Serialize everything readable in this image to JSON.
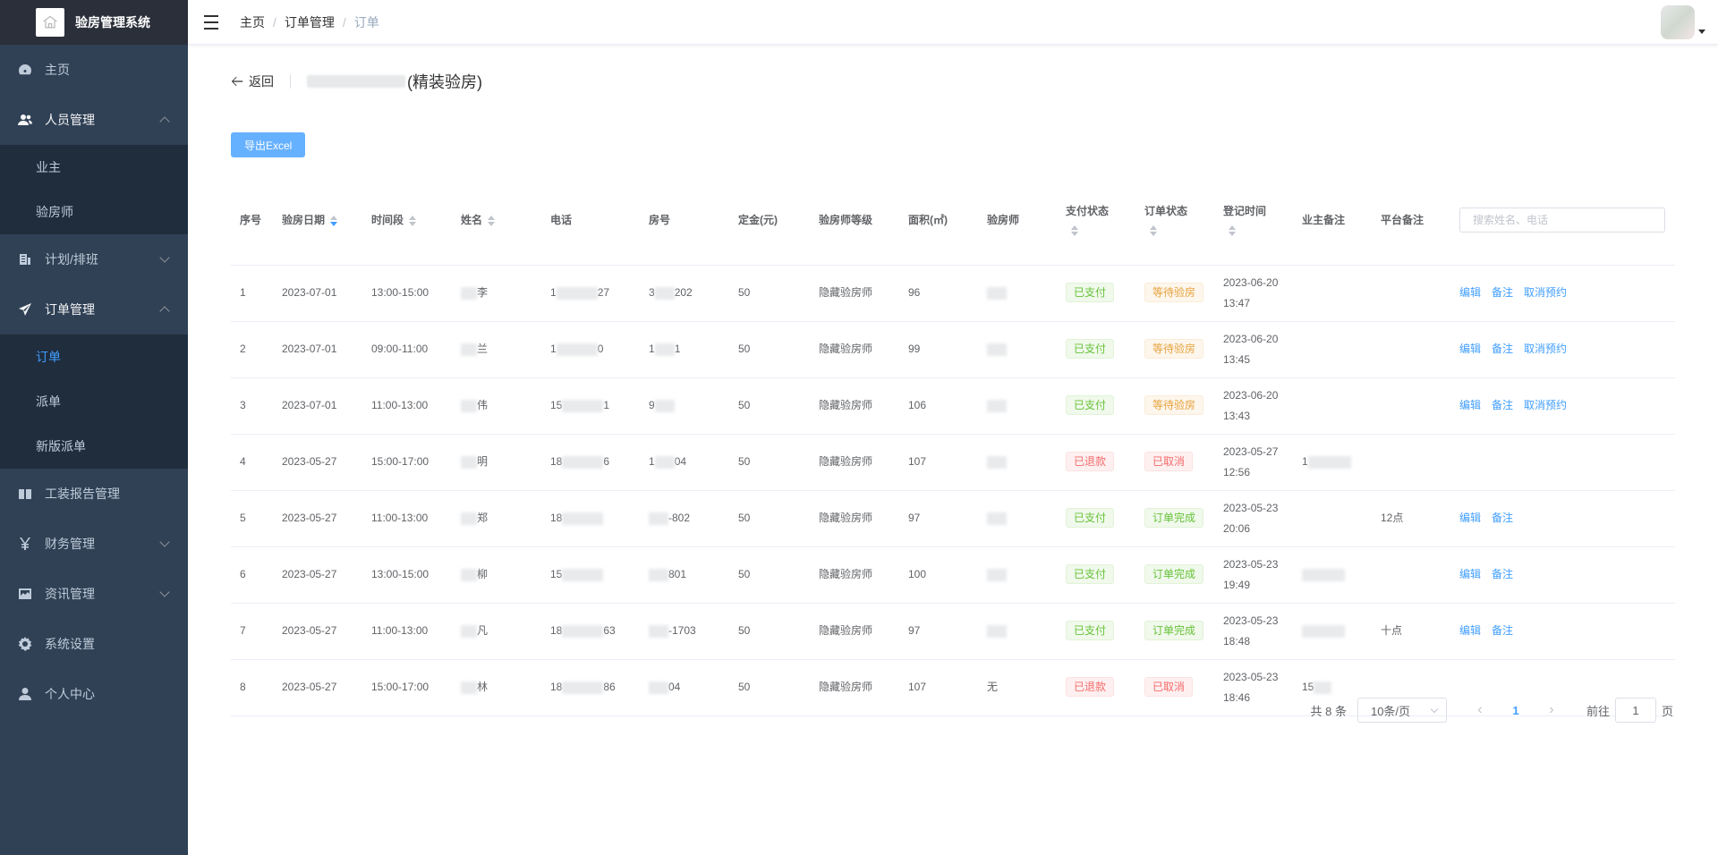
{
  "app": {
    "title": "验房管理系统"
  },
  "sidebar": {
    "items": [
      {
        "label": "主页",
        "icon": "dashboard-icon"
      },
      {
        "label": "人员管理",
        "icon": "users-icon",
        "expanded": true,
        "children": [
          "业主",
          "验房师"
        ]
      },
      {
        "label": "计划/排班",
        "icon": "calendar-icon",
        "expanded": false
      },
      {
        "label": "订单管理",
        "icon": "send-icon",
        "expanded": true,
        "children": [
          "订单",
          "派单",
          "新版派单"
        ]
      },
      {
        "label": "工装报告管理",
        "icon": "book-icon"
      },
      {
        "label": "财务管理",
        "icon": "yen-icon",
        "expanded": false
      },
      {
        "label": "资讯管理",
        "icon": "news-icon",
        "expanded": false
      },
      {
        "label": "系统设置",
        "icon": "gear-icon"
      },
      {
        "label": "个人中心",
        "icon": "user-icon"
      }
    ]
  },
  "breadcrumb": [
    "主页",
    "订单管理",
    "订单"
  ],
  "page_header": {
    "back_label": "返回",
    "title_suffix": "(精装验房)"
  },
  "toolbar": {
    "export_label": "导出Excel"
  },
  "table": {
    "columns": [
      "序号",
      "验房日期",
      "时间段",
      "姓名",
      "电话",
      "房号",
      "定金(元)",
      "验房师等级",
      "面积(㎡)",
      "验房师",
      "支付状态",
      "订单状态",
      "登记时间",
      "业主备注",
      "平台备注"
    ],
    "search_placeholder": "搜索姓名、电话",
    "rows": [
      {
        "idx": "1",
        "date": "2023-07-01",
        "time": "13:00-15:00",
        "name": "李",
        "phone_a": "1",
        "phone_b": "27",
        "room_a": "3",
        "room_b": "202",
        "deposit": "50",
        "level": "隐藏验房师",
        "area": "96",
        "inspector": "",
        "pay": "已支付",
        "pay_type": "success",
        "order": "等待验房",
        "order_type": "warning",
        "reg_date": "2023-06-20",
        "reg_time": "13:47",
        "owner_note": "",
        "platform_note": "",
        "ops": [
          "编辑",
          "备注",
          "取消预约"
        ]
      },
      {
        "idx": "2",
        "date": "2023-07-01",
        "time": "09:00-11:00",
        "name": "兰",
        "phone_a": "1",
        "phone_b": "0",
        "room_a": "1",
        "room_b": "1",
        "deposit": "50",
        "level": "隐藏验房师",
        "area": "99",
        "inspector": "",
        "pay": "已支付",
        "pay_type": "success",
        "order": "等待验房",
        "order_type": "warning",
        "reg_date": "2023-06-20",
        "reg_time": "13:45",
        "owner_note": "",
        "platform_note": "",
        "ops": [
          "编辑",
          "备注",
          "取消预约"
        ]
      },
      {
        "idx": "3",
        "date": "2023-07-01",
        "time": "11:00-13:00",
        "name": "伟",
        "phone_a": "15",
        "phone_b": "1",
        "room_a": "9",
        "room_b": "",
        "deposit": "50",
        "level": "隐藏验房师",
        "area": "106",
        "inspector": "",
        "pay": "已支付",
        "pay_type": "success",
        "order": "等待验房",
        "order_type": "warning",
        "reg_date": "2023-06-20",
        "reg_time": "13:43",
        "owner_note": "",
        "platform_note": "",
        "ops": [
          "编辑",
          "备注",
          "取消预约"
        ]
      },
      {
        "idx": "4",
        "date": "2023-05-27",
        "time": "15:00-17:00",
        "name": "明",
        "phone_a": "18",
        "phone_b": "6",
        "room_a": "1",
        "room_b": "04",
        "deposit": "50",
        "level": "隐藏验房师",
        "area": "107",
        "inspector": "",
        "pay": "已退款",
        "pay_type": "danger",
        "order": "已取消",
        "order_type": "danger",
        "reg_date": "2023-05-27",
        "reg_time": "12:56",
        "owner_note": "1",
        "platform_note": "",
        "ops": []
      },
      {
        "idx": "5",
        "date": "2023-05-27",
        "time": "11:00-13:00",
        "name": "郑",
        "phone_a": "18",
        "phone_b": "",
        "room_a": "",
        "room_b": "-802",
        "deposit": "50",
        "level": "隐藏验房师",
        "area": "97",
        "inspector": "",
        "pay": "已支付",
        "pay_type": "success",
        "order": "订单完成",
        "order_type": "success",
        "reg_date": "2023-05-23",
        "reg_time": "20:06",
        "owner_note": "",
        "platform_note": "12点",
        "ops": [
          "编辑",
          "备注"
        ]
      },
      {
        "idx": "6",
        "date": "2023-05-27",
        "time": "13:00-15:00",
        "name": "柳",
        "phone_a": "15",
        "phone_b": "",
        "room_a": "",
        "room_b": "801",
        "deposit": "50",
        "level": "隐藏验房师",
        "area": "100",
        "inspector": "",
        "pay": "已支付",
        "pay_type": "success",
        "order": "订单完成",
        "order_type": "success",
        "reg_date": "2023-05-23",
        "reg_time": "19:49",
        "owner_note": "",
        "platform_note": "",
        "ops": [
          "编辑",
          "备注"
        ]
      },
      {
        "idx": "7",
        "date": "2023-05-27",
        "time": "11:00-13:00",
        "name": "凡",
        "phone_a": "18",
        "phone_b": "63",
        "room_a": "",
        "room_b": "-1703",
        "deposit": "50",
        "level": "隐藏验房师",
        "area": "97",
        "inspector": "",
        "pay": "已支付",
        "pay_type": "success",
        "order": "订单完成",
        "order_type": "success",
        "reg_date": "2023-05-23",
        "reg_time": "18:48",
        "owner_note": "",
        "platform_note": "十点",
        "ops": [
          "编辑",
          "备注"
        ]
      },
      {
        "idx": "8",
        "date": "2023-05-27",
        "time": "15:00-17:00",
        "name": "林",
        "phone_a": "18",
        "phone_b": "86",
        "room_a": "",
        "room_b": "04",
        "deposit": "50",
        "level": "隐藏验房师",
        "area": "107",
        "inspector": "无",
        "pay": "已退款",
        "pay_type": "danger",
        "order": "已取消",
        "order_type": "danger",
        "reg_date": "2023-05-23",
        "reg_time": "18:46",
        "owner_note": "15",
        "platform_note": "",
        "ops": []
      }
    ]
  },
  "pagination": {
    "total_label": "共 8 条",
    "page_size": "10条/页",
    "current_page": "1",
    "goto_label": "前往",
    "goto_value": "1",
    "page_unit": "页"
  },
  "colors": {
    "sidebar_bg": "#304156",
    "accent": "#409eff",
    "success": "#67c23a",
    "warning": "#e6a23c",
    "danger": "#f56c6c"
  }
}
